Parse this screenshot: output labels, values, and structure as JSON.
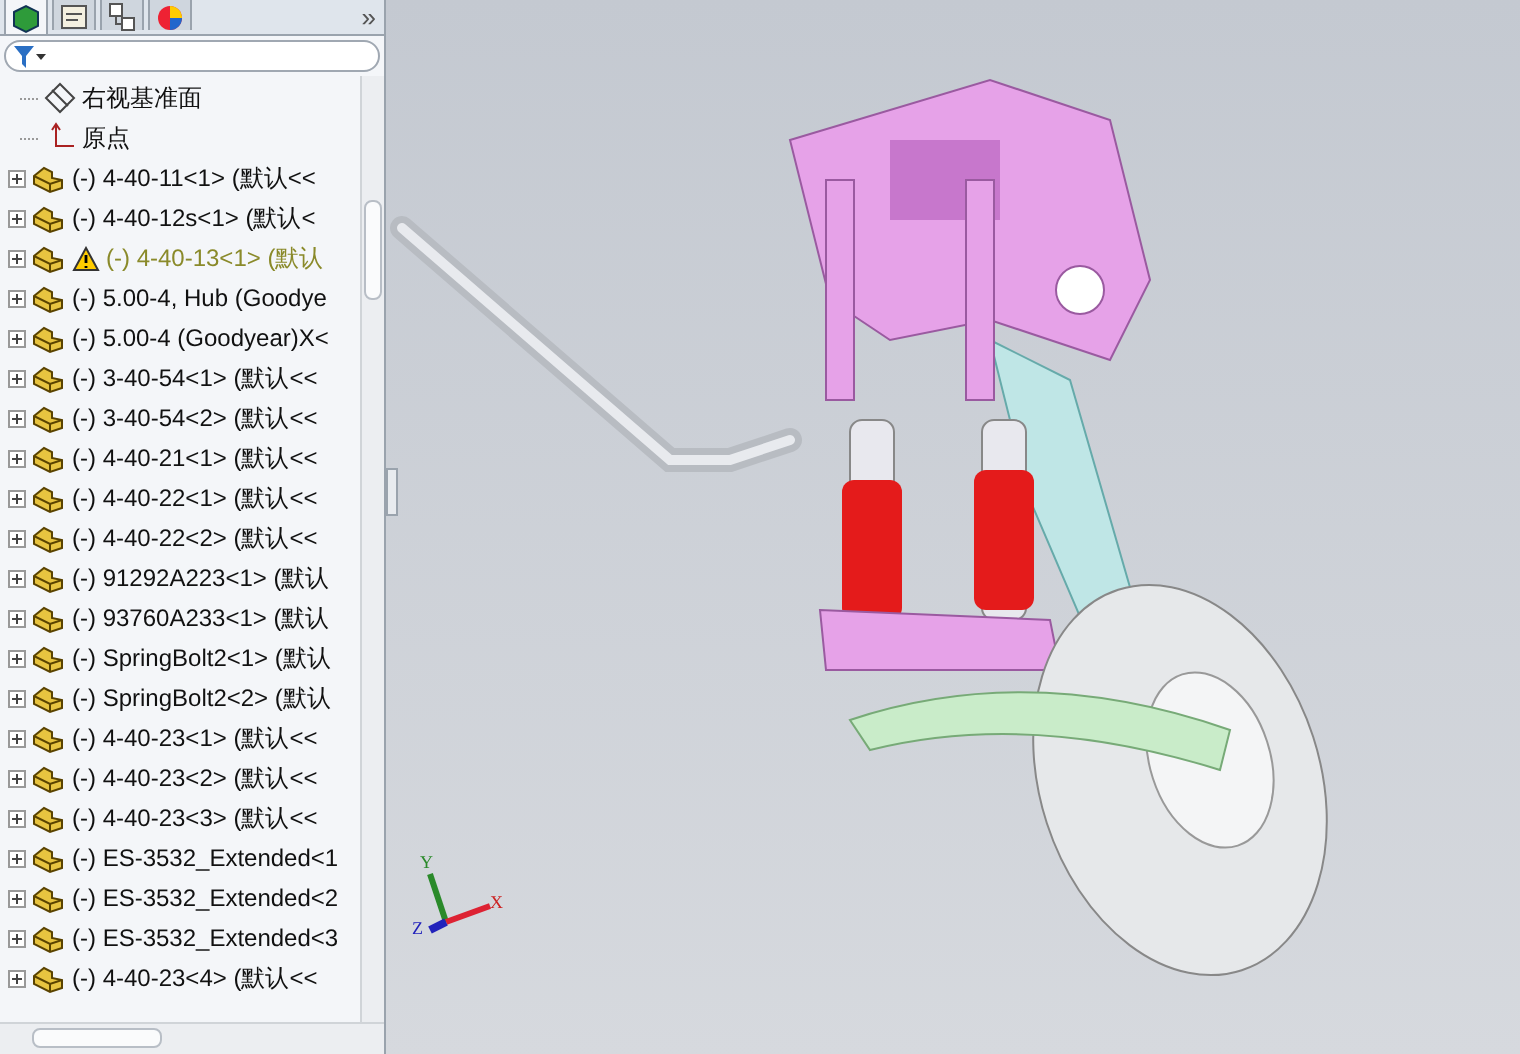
{
  "panel_tabs": [
    {
      "kind": "feature",
      "selected": true
    },
    {
      "kind": "property",
      "selected": false
    },
    {
      "kind": "config",
      "selected": false
    },
    {
      "kind": "appearance",
      "selected": false
    }
  ],
  "overflow_label": "»",
  "tree": [
    {
      "kind": "plane",
      "label": "右视基准面",
      "warning": false
    },
    {
      "kind": "origin",
      "label": "原点",
      "warning": false
    },
    {
      "kind": "part",
      "label": "(-) 4-40-11<1> (默认<<",
      "warning": false
    },
    {
      "kind": "part",
      "label": "(-) 4-40-12s<1> (默认<",
      "warning": false
    },
    {
      "kind": "part",
      "label": "(-) 4-40-13<1> (默认",
      "warning": true
    },
    {
      "kind": "part",
      "label": "(-) 5.00-4, Hub (Goodye",
      "warning": false
    },
    {
      "kind": "part",
      "label": "(-) 5.00-4 (Goodyear)X<",
      "warning": false
    },
    {
      "kind": "part",
      "label": "(-) 3-40-54<1> (默认<<",
      "warning": false
    },
    {
      "kind": "part",
      "label": "(-) 3-40-54<2> (默认<<",
      "warning": false
    },
    {
      "kind": "part",
      "label": "(-) 4-40-21<1> (默认<<",
      "warning": false
    },
    {
      "kind": "part",
      "label": "(-) 4-40-22<1> (默认<<",
      "warning": false
    },
    {
      "kind": "part",
      "label": "(-) 4-40-22<2> (默认<<",
      "warning": false
    },
    {
      "kind": "part",
      "label": "(-) 91292A223<1> (默认",
      "warning": false
    },
    {
      "kind": "part",
      "label": "(-) 93760A233<1> (默认",
      "warning": false
    },
    {
      "kind": "part",
      "label": "(-) SpringBolt2<1> (默认",
      "warning": false
    },
    {
      "kind": "part",
      "label": "(-) SpringBolt2<2> (默认",
      "warning": false
    },
    {
      "kind": "part",
      "label": "(-) 4-40-23<1> (默认<<",
      "warning": false
    },
    {
      "kind": "part",
      "label": "(-) 4-40-23<2> (默认<<",
      "warning": false
    },
    {
      "kind": "part",
      "label": "(-) 4-40-23<3> (默认<<",
      "warning": false
    },
    {
      "kind": "part",
      "label": "(-) ES-3532_Extended<1",
      "warning": false
    },
    {
      "kind": "part",
      "label": "(-) ES-3532_Extended<2",
      "warning": false
    },
    {
      "kind": "part",
      "label": "(-) ES-3532_Extended<3",
      "warning": false
    },
    {
      "kind": "part",
      "label": "(-) 4-40-23<4> (默认<<",
      "warning": false
    }
  ],
  "triad": {
    "x": "X",
    "y": "Y",
    "z": "Z"
  }
}
